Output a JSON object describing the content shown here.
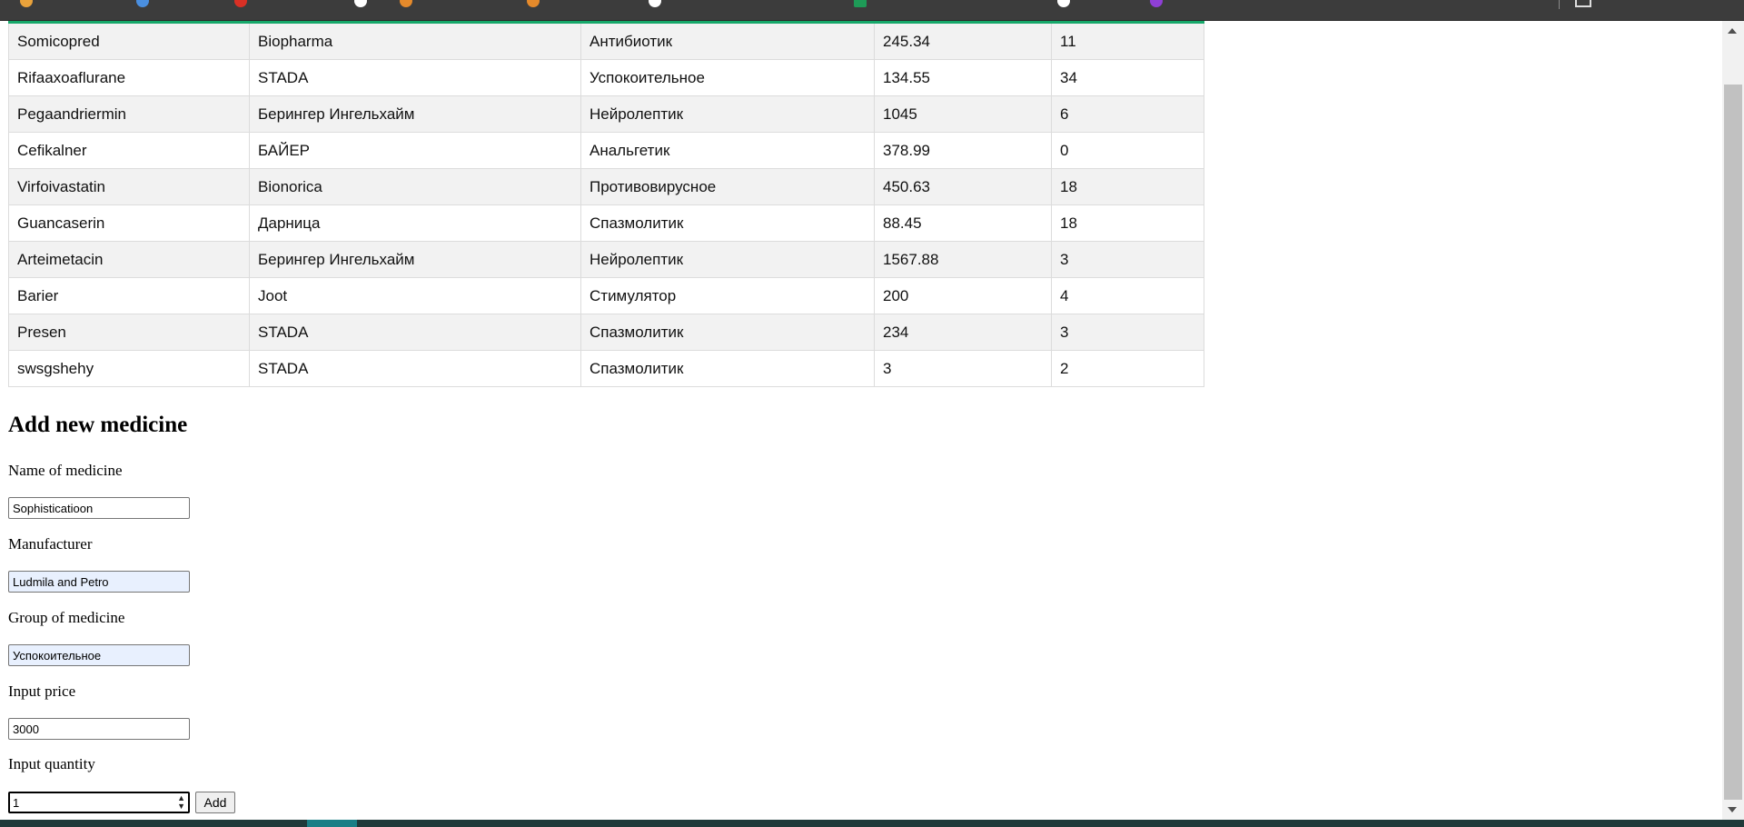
{
  "table": {
    "rows": [
      [
        "Somicopred",
        "Biopharma",
        "Антибиотик",
        "245.34",
        "11"
      ],
      [
        "Rifaaxoaflurane",
        "STADA",
        "Успокоительное",
        "134.55",
        "34"
      ],
      [
        "Pegaandriermin",
        "Берингер Ингельхайм",
        "Нейролептик",
        "1045",
        "6"
      ],
      [
        "Cefikalner",
        "БАЙЕР",
        "Анальгетик",
        "378.99",
        "0"
      ],
      [
        "Virfoivastatin",
        "Bionorica",
        "Противовирусное",
        "450.63",
        "18"
      ],
      [
        "Guancaserin",
        "Дарница",
        "Спазмолитик",
        "88.45",
        "18"
      ],
      [
        "Arteimetacin",
        "Берингер Ингельхайм",
        "Нейролептик",
        "1567.88",
        "3"
      ],
      [
        "Barier",
        "Joot",
        "Стимулятор",
        "200",
        "4"
      ],
      [
        "Presen",
        "STADA",
        "Спазмолитик",
        "234",
        "3"
      ],
      [
        "swsgshehy",
        "STADA",
        "Спазмолитик",
        "3",
        "2"
      ]
    ]
  },
  "form": {
    "title": "Add new medicine",
    "name_label": "Name of medicine",
    "name_value": "Sophisticatioon",
    "manufacturer_label": "Manufacturer",
    "manufacturer_value": "Ludmila and Petro",
    "group_label": "Group of medicine",
    "group_value": "Успокоительное",
    "price_label": "Input price",
    "price_value": "3000",
    "quantity_label": "Input quantity",
    "quantity_value": "1",
    "add_label": "Add"
  },
  "colors": {
    "table_accent": "#16a86a",
    "autofill_bg": "#e8f0fe"
  }
}
